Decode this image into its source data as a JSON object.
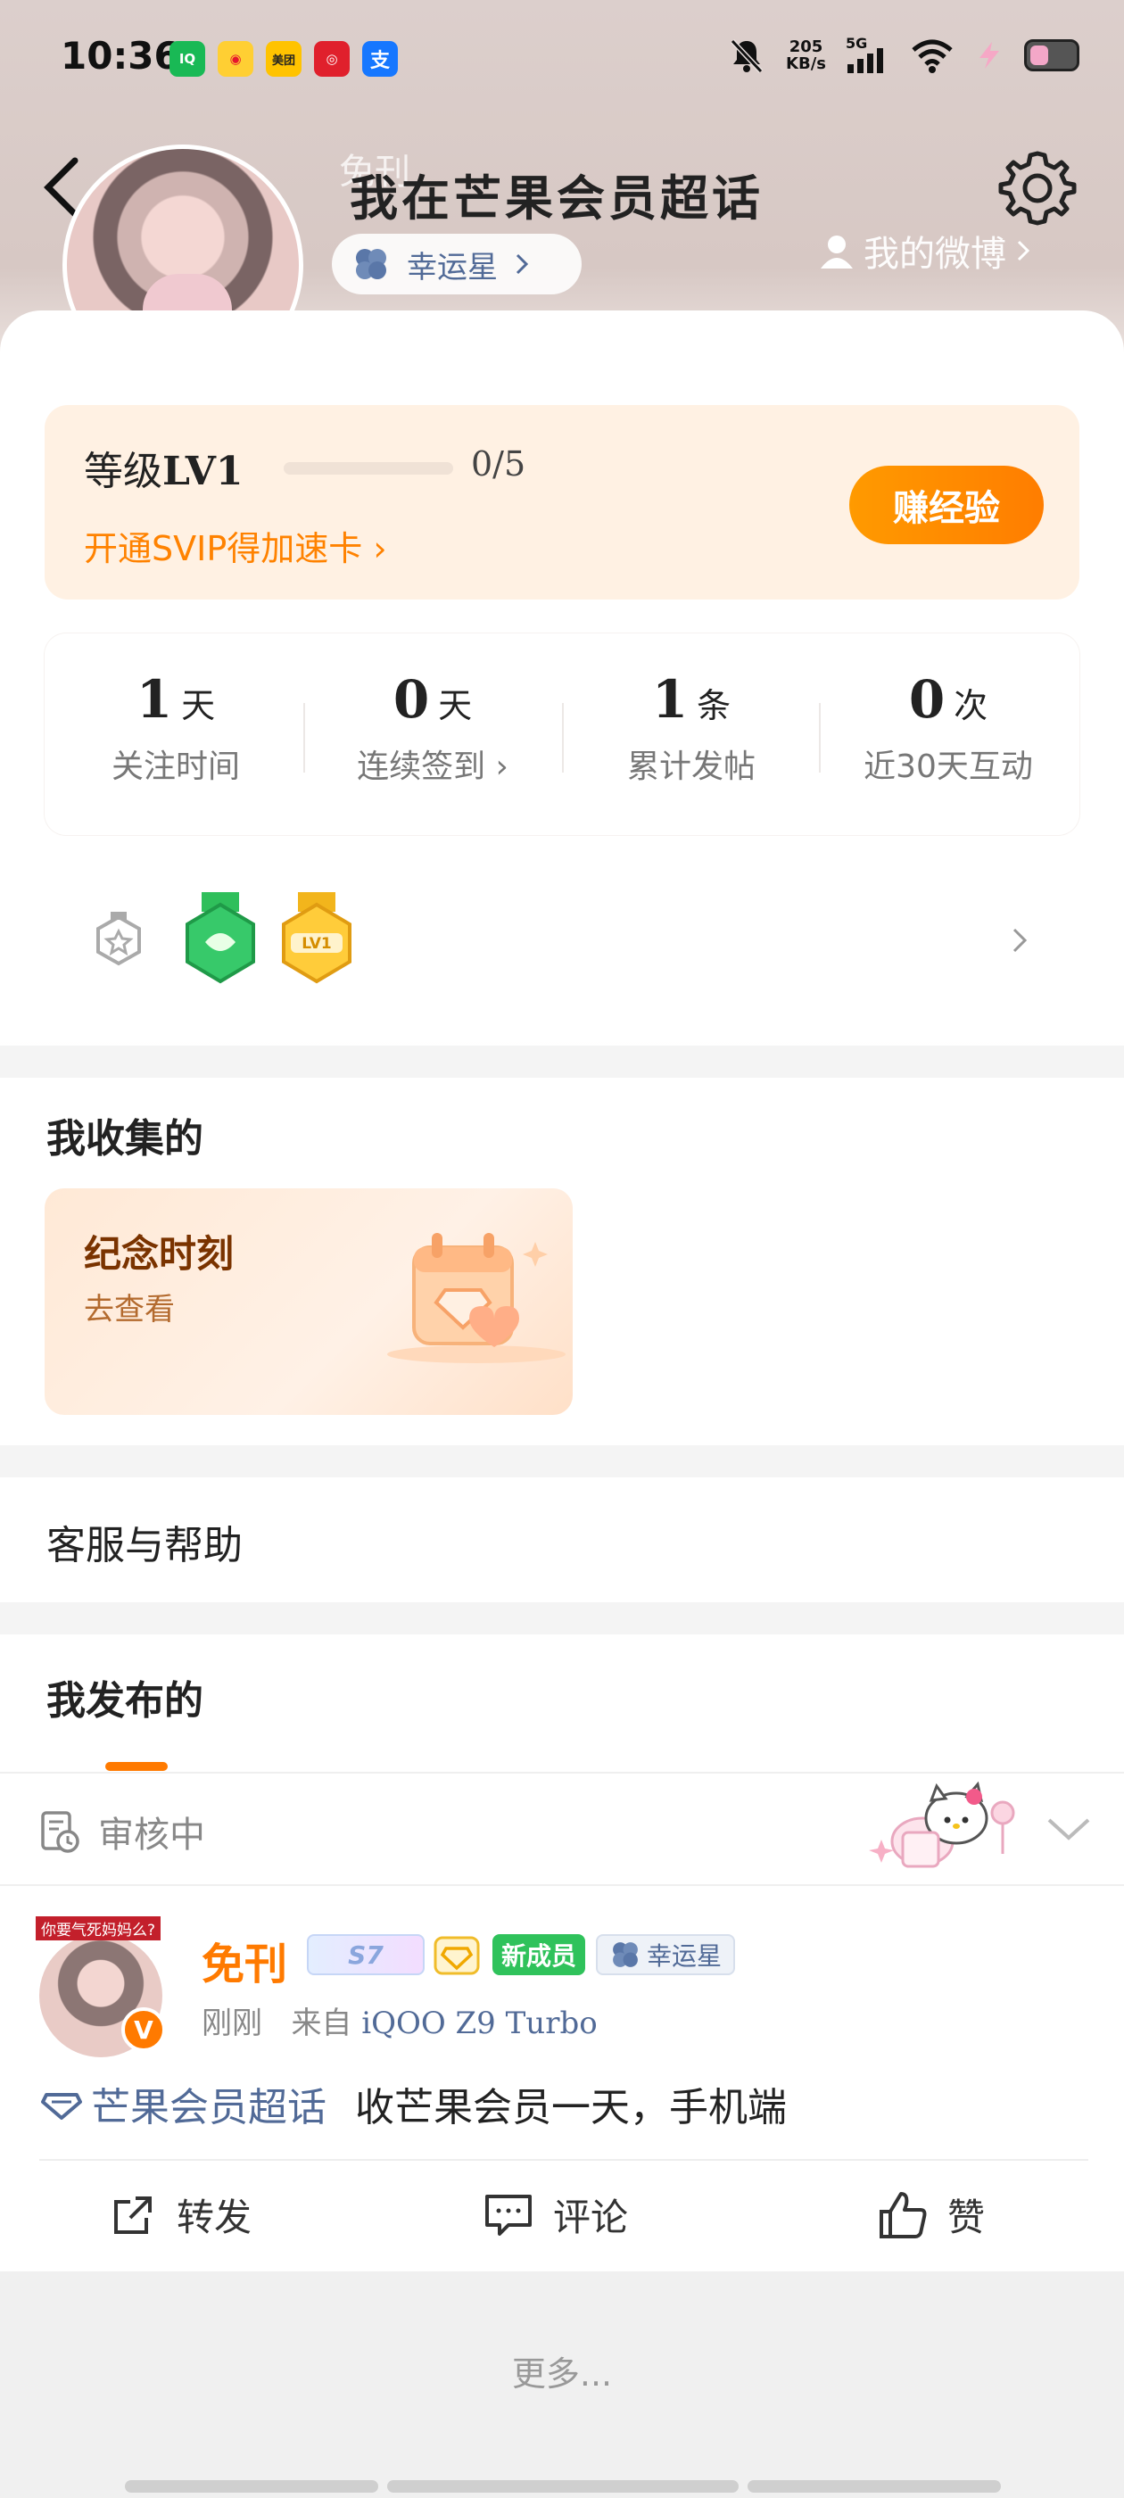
{
  "status_bar": {
    "time": "10:36",
    "apps": [
      "iQIYI",
      "Weibo",
      "美团",
      "NetEase",
      "支付宝"
    ],
    "net_speed": "205",
    "net_unit": "KB/s",
    "network": "5G"
  },
  "header": {
    "title": "我在芒果会员超话",
    "ghost_name": "免刊",
    "lucky_label": "幸运星",
    "my_weibo": "我的微博"
  },
  "level": {
    "prefix": "等级",
    "value": "LV1",
    "progress_text": "0/5",
    "progress_fraction": 0,
    "svip_link": "开通SVIP得加速卡",
    "earn_button": "赚经验"
  },
  "stats": [
    {
      "num": "1",
      "unit": "天",
      "label": "关注时间"
    },
    {
      "num": "0",
      "unit": "天",
      "label": "连续签到"
    },
    {
      "num": "1",
      "unit": "条",
      "label": "累计发帖"
    },
    {
      "num": "0",
      "unit": "次",
      "label": "近30天互动"
    }
  ],
  "badges": {
    "lv_badge": "LV1"
  },
  "collect": {
    "section_title": "我收集的",
    "card_title": "纪念时刻",
    "card_sub": "去查看"
  },
  "service": {
    "title": "客服与帮助"
  },
  "published": {
    "title": "我发布的",
    "review_status": "审核中"
  },
  "post": {
    "avatar_tag": "你要气死妈妈么?",
    "author": "免刊",
    "tag_new": "新成员",
    "tag_lucky": "幸运星",
    "tag_level": "S7",
    "time": "刚刚",
    "from_label": "来自",
    "device": "iQOO Z9 Turbo",
    "topic": "芒果会员超话",
    "text": "收芒果会员一天，手机端",
    "actions": {
      "repost": "转发",
      "comment": "评论",
      "like": "赞"
    }
  },
  "more": "更多...",
  "colors": {
    "accent": "#ff7a00",
    "link": "#516a97",
    "bg_gray": "#f4f4f4"
  }
}
